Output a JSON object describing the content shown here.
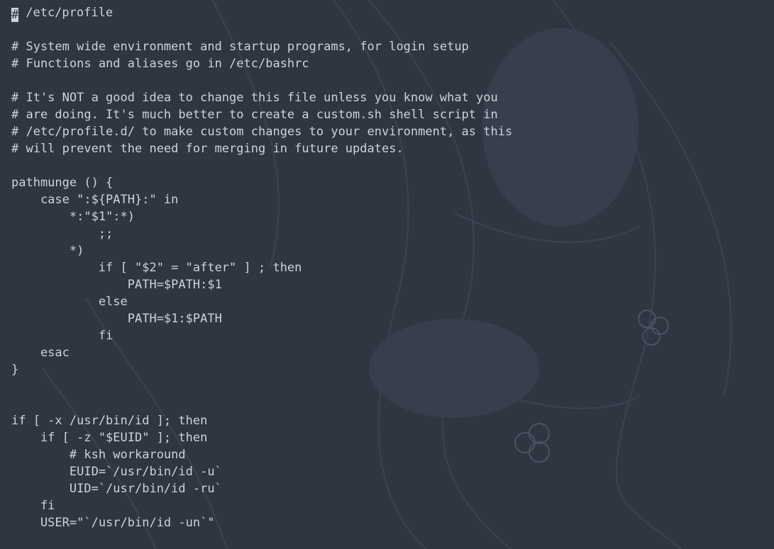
{
  "editor": {
    "cursor_char": "#",
    "lines": [
      " /etc/profile",
      "",
      "# System wide environment and startup programs, for login setup",
      "# Functions and aliases go in /etc/bashrc",
      "",
      "# It's NOT a good idea to change this file unless you know what you",
      "# are doing. It's much better to create a custom.sh shell script in",
      "# /etc/profile.d/ to make custom changes to your environment, as this",
      "# will prevent the need for merging in future updates.",
      "",
      "pathmunge () {",
      "    case \":${PATH}:\" in",
      "        *:\"$1\":*)",
      "            ;;",
      "        *)",
      "            if [ \"$2\" = \"after\" ] ; then",
      "                PATH=$PATH:$1",
      "            else",
      "                PATH=$1:$PATH",
      "            fi",
      "    esac",
      "}",
      "",
      "",
      "if [ -x /usr/bin/id ]; then",
      "    if [ -z \"$EUID\" ]; then",
      "        # ksh workaround",
      "        EUID=`/usr/bin/id -u`",
      "        UID=`/usr/bin/id -ru`",
      "    fi",
      "    USER=\"`/usr/bin/id -un`\""
    ]
  },
  "colors": {
    "background": "#2f3642",
    "text": "#cdd3dc"
  }
}
